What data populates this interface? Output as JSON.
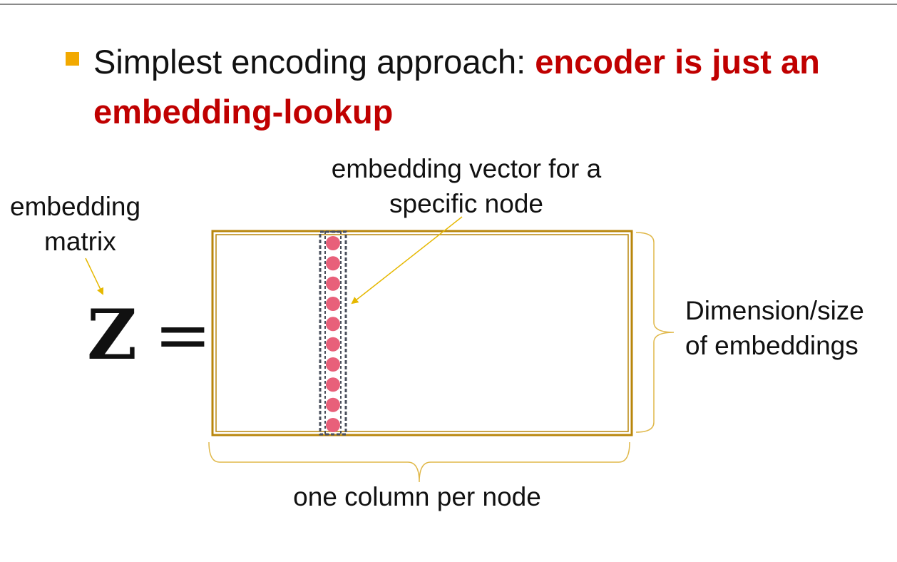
{
  "heading": {
    "plain": "Simplest encoding approach: ",
    "emphasis": "encoder is just an embedding-lookup"
  },
  "labels": {
    "matrix_line1": "embedding",
    "matrix_line2": "matrix",
    "vector_line1": "embedding vector for a",
    "vector_line2": "specific node",
    "dimension_line1": "Dimension/size",
    "dimension_line2": "of embeddings",
    "column": "one column per node"
  },
  "equation": {
    "symbol": "Z",
    "equals": "="
  },
  "vector": {
    "element_count": 10
  },
  "colors": {
    "matrix_border": "#b8860b",
    "bracket": "#e0b84a",
    "arrow": "#e6b800",
    "vector_dot": "#e8607a",
    "vector_outline": "#4a4f5c",
    "bullet": "#f2a900",
    "emphasis": "#c00000"
  }
}
